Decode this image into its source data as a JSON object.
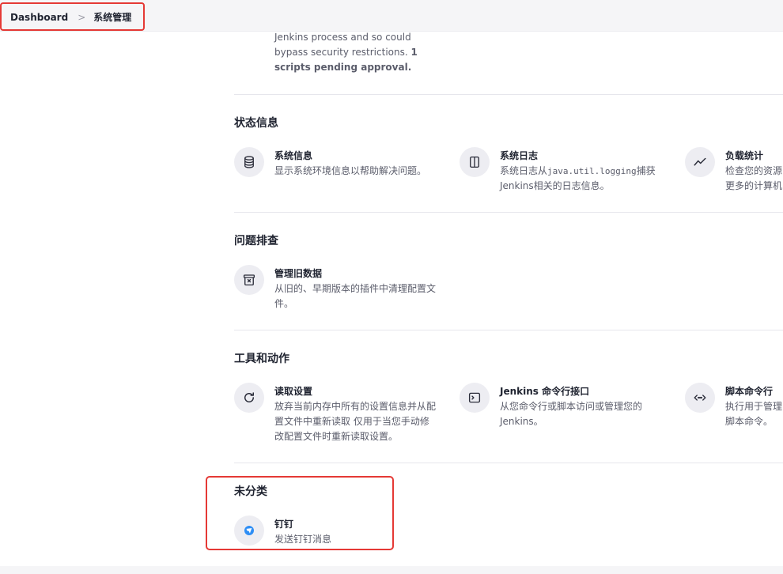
{
  "breadcrumb": {
    "root": "Dashboard",
    "separator": ">",
    "current": "系统管理"
  },
  "top_text": {
    "line1": "Jenkins process and so could",
    "line2": "bypass security restrictions.",
    "bold_tail": "1",
    "line3": "scripts pending approval."
  },
  "sections": {
    "status": {
      "title": "状态信息",
      "items": [
        {
          "title": "系统信息",
          "desc_line1": "显示系统环境信息以帮助解决问题。",
          "icon": "database-icon"
        },
        {
          "title": "系统日志",
          "desc_prefix": "系统日志从",
          "desc_code": "java.util.logging",
          "desc_suffix": "捕获",
          "desc_line2": "Jenkins相关的日志信息。",
          "icon": "log-panel-icon"
        },
        {
          "title": "负载统计",
          "desc_line1": "检查您的资源",
          "desc_line2": "更多的计算机",
          "icon": "trend-line-icon"
        }
      ]
    },
    "troubleshooting": {
      "title": "问题排查",
      "items": [
        {
          "title": "管理旧数据",
          "desc_line1": "从旧的、早期版本的插件中清理配置文",
          "desc_line2": "件。",
          "icon": "archive-x-icon"
        }
      ]
    },
    "tools": {
      "title": "工具和动作",
      "items": [
        {
          "title": "读取设置",
          "desc_line1": "放弃当前内存中所有的设置信息并从配",
          "desc_line2": "置文件中重新读取 仅用于当您手动修",
          "desc_line3": "改配置文件时重新读取设置。",
          "icon": "reload-icon"
        },
        {
          "title": "Jenkins 命令行接口",
          "desc_line1": "从您命令行或脚本访问或管理您的",
          "desc_line2": "Jenkins。",
          "icon": "terminal-icon"
        },
        {
          "title": "脚本命令行",
          "desc_line1": "执行用于管理",
          "desc_line2": "脚本命令。",
          "icon": "code-icon"
        }
      ]
    },
    "uncategorized": {
      "title": "未分类",
      "items": [
        {
          "title": "钉钉",
          "desc_line1": "发送钉钉消息",
          "icon": "dingtalk-icon"
        }
      ]
    }
  },
  "colors": {
    "highlight": "#e53935",
    "icon_bg": "#ededf2",
    "dingtalk_blue": "#2e8ef5"
  }
}
